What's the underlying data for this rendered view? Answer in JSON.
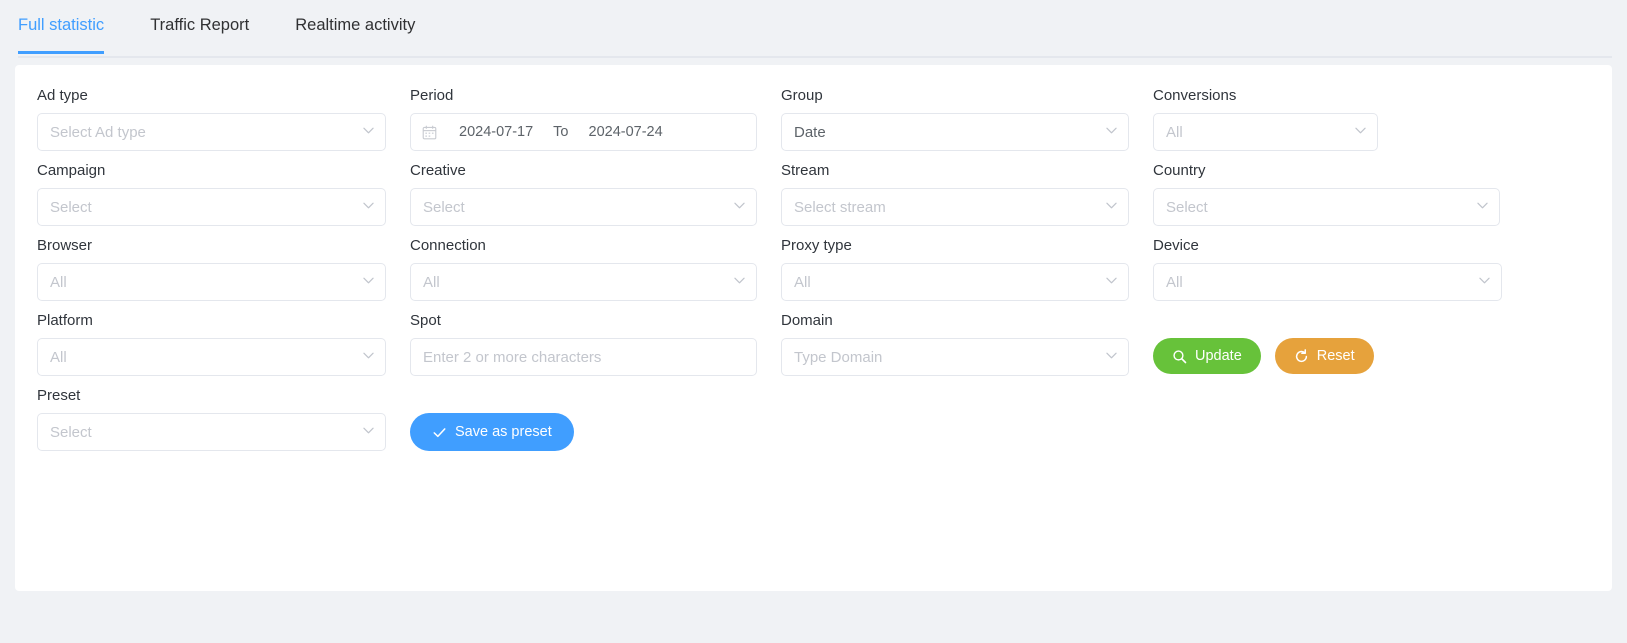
{
  "tabs": [
    {
      "label": "Full statistic",
      "active": true
    },
    {
      "label": "Traffic Report",
      "active": false
    },
    {
      "label": "Realtime activity",
      "active": false
    }
  ],
  "filters": {
    "ad_type": {
      "label": "Ad type",
      "placeholder": "Select Ad type"
    },
    "period": {
      "label": "Period",
      "from": "2024-07-17",
      "to_label": "To",
      "to": "2024-07-24"
    },
    "group": {
      "label": "Group",
      "value": "Date"
    },
    "conversions": {
      "label": "Conversions",
      "placeholder": "All"
    },
    "campaign": {
      "label": "Campaign",
      "placeholder": "Select"
    },
    "creative": {
      "label": "Creative",
      "placeholder": "Select"
    },
    "stream": {
      "label": "Stream",
      "placeholder": "Select stream"
    },
    "country": {
      "label": "Country",
      "placeholder": "Select"
    },
    "browser": {
      "label": "Browser",
      "placeholder": "All"
    },
    "connection": {
      "label": "Connection",
      "placeholder": "All"
    },
    "proxy_type": {
      "label": "Proxy type",
      "placeholder": "All"
    },
    "device": {
      "label": "Device",
      "placeholder": "All"
    },
    "platform": {
      "label": "Platform",
      "placeholder": "All"
    },
    "spot": {
      "label": "Spot",
      "placeholder": "Enter 2 or more characters"
    },
    "domain": {
      "label": "Domain",
      "placeholder": "Type Domain"
    },
    "preset": {
      "label": "Preset",
      "placeholder": "Select"
    }
  },
  "actions": {
    "update": "Update",
    "reset": "Reset",
    "save_preset": "Save as preset"
  },
  "colors": {
    "accent": "#409eff",
    "update": "#67c23a",
    "reset": "#e6a23c",
    "preset": "#409eff",
    "page_bg": "#f0f2f5"
  }
}
